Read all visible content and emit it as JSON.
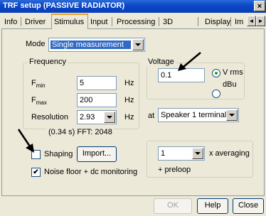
{
  "window": {
    "title": "TRF setup (PASSIVE RADIATOR)",
    "close_glyph": "×"
  },
  "tabs": [
    {
      "label": "Info"
    },
    {
      "label": "Driver"
    },
    {
      "label": "Stimulus",
      "active": true
    },
    {
      "label": "Input"
    },
    {
      "label": "Processing"
    },
    {
      "label": "3D"
    },
    {
      "label": "Display"
    },
    {
      "label": "Im"
    }
  ],
  "tab_scroll": {
    "left_glyph": "◄",
    "right_glyph": "►"
  },
  "mode": {
    "label": "Mode",
    "value": "Single measurement"
  },
  "frequency": {
    "title": "Frequency",
    "fmin": {
      "label_main": "F",
      "label_sub": "min",
      "value": "5",
      "unit": "Hz"
    },
    "fmax": {
      "label_main": "F",
      "label_sub": "max",
      "value": "200",
      "unit": "Hz"
    },
    "resolution": {
      "label": "Resolution",
      "value": "2.93",
      "unit": "Hz"
    },
    "timing_text": "(0.34 s)  FFT: 2048"
  },
  "voltage": {
    "title": "Voltage",
    "value": "0.1",
    "units": [
      {
        "label": "V rms",
        "selected": true
      },
      {
        "label": "dBu",
        "selected": false
      }
    ],
    "at_label": "at",
    "target": "Speaker 1 terminals"
  },
  "shaping": {
    "label": "Shaping",
    "checked": false,
    "check_glyph": "",
    "import_label": "Import..."
  },
  "noise_floor": {
    "label": "Noise floor + dc  monitoring",
    "checked": true,
    "check_glyph": "✔"
  },
  "averaging": {
    "value": "1",
    "label": "x  averaging",
    "preloop": "+ preloop"
  },
  "footer": {
    "ok_label": "OK",
    "help_label": "Help",
    "close_label": "Close"
  }
}
